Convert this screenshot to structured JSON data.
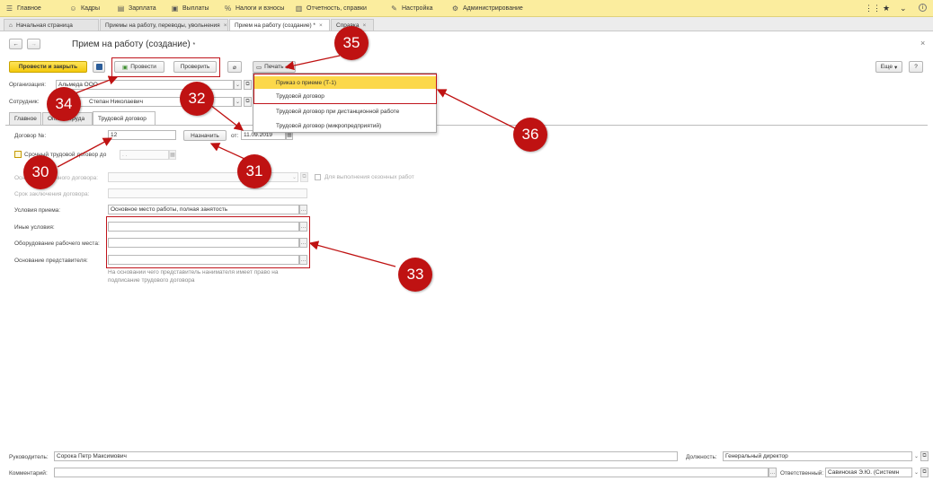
{
  "menu": {
    "items": [
      {
        "icon": "menu-icon",
        "glyph": "☰",
        "label": "Главное"
      },
      {
        "icon": "people-icon",
        "glyph": "👥",
        "label": "Кадры"
      },
      {
        "icon": "salary-icon",
        "glyph": "▤",
        "label": "Зарплата"
      },
      {
        "icon": "payments-icon",
        "glyph": "▣",
        "label": "Выплаты"
      },
      {
        "icon": "percent-icon",
        "glyph": "%",
        "label": "Налоги и взносы"
      },
      {
        "icon": "reports-icon",
        "glyph": "▥",
        "label": "Отчетность, справки"
      },
      {
        "icon": "wrench-icon",
        "glyph": "✎",
        "label": "Настройка"
      },
      {
        "icon": "gear-icon",
        "glyph": "⚙",
        "label": "Администрирование"
      }
    ],
    "right_icons": [
      "⋮⋮",
      "★",
      "⌄",
      "i"
    ]
  },
  "tabs": [
    {
      "icon": "home-icon",
      "label": "Начальная страница"
    },
    {
      "label": "Приемы на работу, переводы, увольнения"
    },
    {
      "label": "Прием на работу (создание) *"
    },
    {
      "label": "Справка"
    }
  ],
  "form": {
    "title": "Прием на работу (создание)",
    "title_mark": "*",
    "close_glyph": "×",
    "toolbar": {
      "post_close": "Провести и закрыть",
      "post": "Провести",
      "check": "Проверить",
      "print": "Печать",
      "more": "Еще",
      "help": "?"
    },
    "organization_label": "Организация:",
    "organization_value": "Альмеда ООО",
    "employee_label": "Сотрудник:",
    "employee_value": "Степан Николаевич",
    "tabs": [
      "Главное",
      "Оплата труда",
      "Трудовой договор"
    ],
    "contract_no_label": "Договор №:",
    "contract_no_value": "12",
    "assign_button": "Назначить",
    "from_label": "от:",
    "date_value": "11.09.2019",
    "fixed_term_label": "Срочный трудовой договор до",
    "fixed_term_date": ". .",
    "basis_label": "Основание срочного договора:",
    "seasonal_label": "Для выполнения сезонных работ",
    "term_label": "Срок заключения договора:",
    "conditions_label": "Условия приема:",
    "conditions_value": "Основное место работы, полная занятость",
    "other_label": "Иные условия:",
    "equipment_label": "Оборудование рабочего места:",
    "rep_basis_label": "Основание представителя:",
    "rep_hint": "На основании чего представитель нанимателя имеет право на подписание трудового договора",
    "manager_label": "Руководитель:",
    "manager_value": "Сорока Петр Максимович",
    "position_label": "Должность:",
    "position_value": "Генеральный директор",
    "comment_label": "Комментарий:",
    "responsible_label": "Ответственный:",
    "responsible_value": "Савинская Э.Ю. (Системн"
  },
  "print_menu": [
    {
      "label": "Приказ о приеме (Т-1)",
      "selected": true
    },
    {
      "label": "Трудовой договор",
      "selected": false
    },
    {
      "label": "Трудовой договор при дистанционной работе",
      "selected": false
    },
    {
      "label": "Трудовой договор (микропредприятий)",
      "selected": false
    }
  ],
  "annotations": [
    "30",
    "31",
    "32",
    "33",
    "34",
    "35",
    "36"
  ],
  "colors": {
    "menubar": "#fbed9e",
    "accent_yellow": "#f4c80c",
    "annotation_red": "#bf1212"
  }
}
